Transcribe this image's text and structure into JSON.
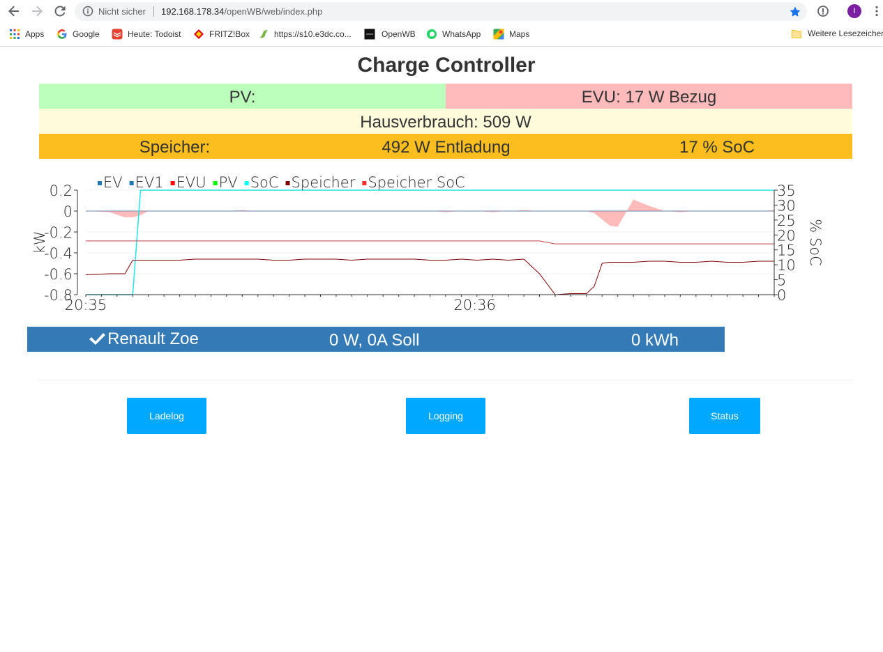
{
  "browser": {
    "security_label": "Nicht sicher",
    "url_host": "192.168.178.34",
    "url_path": "/openWB/web/index.php",
    "profile_initial": "I",
    "bookmarks": [
      {
        "label": "Apps",
        "icon": "apps-grid-icon"
      },
      {
        "label": "Google",
        "icon": "google-icon"
      },
      {
        "label": "Heute: Todoist",
        "icon": "todoist-icon"
      },
      {
        "label": "FRITZ!Box",
        "icon": "fritzbox-icon"
      },
      {
        "label": "https://s10.e3dc.co...",
        "icon": "e3dc-icon"
      },
      {
        "label": "OpenWB",
        "icon": "openwb-icon"
      },
      {
        "label": "WhatsApp",
        "icon": "whatsapp-icon"
      },
      {
        "label": "Maps",
        "icon": "maps-icon"
      }
    ],
    "other_bookmarks": "Weitere Lesezeichen"
  },
  "page": {
    "title": "Charge Controller"
  },
  "status": {
    "pv": "PV:",
    "evu": "EVU: 17 W Bezug",
    "hausverbrauch": "Hausverbrauch: 509 W",
    "speicher_label": "Speicher:",
    "speicher_power": "492 W Entladung",
    "speicher_soc": "17 % SoC"
  },
  "colors": {
    "pv_bg": "#bbffbb",
    "evu_bg": "#ffbbbb",
    "haus_bg": "#fffcdb",
    "speicher_bg": "#fcbe1e",
    "ladepunkt_bg": "#337ab7",
    "button_bg": "#00a8ff"
  },
  "chart_data": {
    "type": "line",
    "ylabel": "kW",
    "y2label": "% SoC",
    "ylim": [
      -0.8,
      0.2
    ],
    "y2lim": [
      0,
      35
    ],
    "yticks": [
      "0.2",
      "0",
      "-0.2",
      "-0.4",
      "-0.6",
      "-0.8"
    ],
    "y2ticks": [
      "35",
      "30",
      "25",
      "20",
      "15",
      "10",
      "5",
      "0"
    ],
    "x_tick_labels": [
      "20:35",
      "20:36"
    ],
    "legend": [
      "EV",
      "EV1",
      "EVU",
      "PV",
      "SoC",
      "Speicher",
      "Speicher SoC"
    ],
    "legend_position": "top-left",
    "x": [
      0,
      3,
      5,
      6,
      7,
      8,
      10,
      12,
      14,
      16,
      18,
      20,
      22,
      24,
      26,
      28,
      30,
      32,
      34,
      36,
      38,
      40,
      42,
      44,
      46,
      48,
      50,
      52,
      54,
      56,
      58,
      60,
      62,
      64,
      65,
      66,
      67,
      68,
      70,
      72,
      74,
      76,
      78,
      80,
      82,
      84,
      86,
      88
    ],
    "series": [
      {
        "name": "EV",
        "axis": "left",
        "values": [
          0,
          0,
          0,
          0,
          0,
          0,
          0,
          0,
          0,
          0,
          0,
          0,
          0,
          0,
          0,
          0,
          0,
          0,
          0,
          0,
          0,
          0,
          0,
          0,
          0,
          0,
          0,
          0,
          0,
          0,
          0,
          0,
          0,
          0,
          0,
          0,
          0,
          0,
          0,
          0,
          0,
          0,
          0,
          0,
          0,
          0,
          0,
          0
        ]
      },
      {
        "name": "EV1",
        "axis": "left",
        "values": [
          0,
          0,
          0,
          0,
          0,
          0,
          0,
          0,
          0,
          0,
          0,
          0,
          0,
          0,
          0,
          0,
          0,
          0,
          0,
          0,
          0,
          0,
          0,
          0,
          0,
          0,
          0,
          0,
          0,
          0,
          0,
          0,
          0,
          0,
          0,
          0,
          0,
          0,
          0,
          0,
          0,
          0,
          0,
          0,
          0,
          0,
          0,
          0
        ]
      },
      {
        "name": "EVU",
        "axis": "left",
        "values": [
          0,
          -0.01,
          -0.06,
          -0.06,
          -0.04,
          0,
          0,
          0,
          0,
          0,
          0,
          0.01,
          0,
          0,
          0,
          0,
          0,
          0,
          0,
          0,
          0,
          0,
          0,
          0,
          -0.01,
          0,
          0,
          -0.01,
          0,
          0.01,
          0,
          0,
          0,
          0,
          -0.02,
          -0.08,
          -0.14,
          -0.15,
          0.11,
          0.05,
          0,
          -0.01,
          0,
          0,
          0,
          0,
          0,
          0.01
        ]
      },
      {
        "name": "PV",
        "axis": "left",
        "values": [
          0,
          0,
          0,
          0,
          0,
          0,
          0,
          0,
          0,
          0,
          0,
          0,
          0,
          0,
          0,
          0,
          0,
          0,
          0,
          0,
          0,
          0,
          0,
          0,
          0,
          0,
          0,
          0,
          0,
          0,
          0,
          0,
          0,
          0,
          0,
          0,
          0,
          0,
          0,
          0,
          0,
          0,
          0,
          0,
          0,
          0,
          0,
          0
        ]
      },
      {
        "name": "SoC",
        "axis": "right",
        "values": [
          0,
          0,
          0,
          0,
          35,
          35,
          35,
          35,
          35,
          35,
          35,
          35,
          35,
          35,
          35,
          35,
          35,
          35,
          35,
          35,
          35,
          35,
          35,
          35,
          35,
          35,
          35,
          35,
          35,
          35,
          35,
          35,
          35,
          35,
          35,
          35,
          35,
          35,
          35,
          35,
          35,
          35,
          35,
          35,
          35,
          35,
          35,
          35
        ]
      },
      {
        "name": "Speicher",
        "axis": "left",
        "values": [
          -0.61,
          -0.6,
          -0.6,
          -0.47,
          -0.47,
          -0.47,
          -0.47,
          -0.47,
          -0.46,
          -0.46,
          -0.46,
          -0.46,
          -0.46,
          -0.47,
          -0.47,
          -0.46,
          -0.46,
          -0.46,
          -0.47,
          -0.46,
          -0.46,
          -0.46,
          -0.46,
          -0.47,
          -0.47,
          -0.46,
          -0.47,
          -0.46,
          -0.47,
          -0.46,
          -0.6,
          -0.8,
          -0.79,
          -0.79,
          -0.72,
          -0.5,
          -0.49,
          -0.49,
          -0.49,
          -0.48,
          -0.48,
          -0.49,
          -0.49,
          -0.48,
          -0.49,
          -0.49,
          -0.48,
          -0.48
        ]
      },
      {
        "name": "Speicher SoC",
        "axis": "right",
        "values": [
          18,
          18,
          18,
          18,
          18,
          18,
          18,
          18,
          18,
          18,
          18,
          18,
          18,
          18,
          18,
          18,
          18,
          18,
          18,
          18,
          18,
          18,
          18,
          18,
          18,
          18,
          18,
          18,
          18,
          18,
          18,
          17,
          17,
          17,
          17,
          17,
          17,
          17,
          17,
          17,
          17,
          17,
          17,
          17,
          17,
          17,
          17,
          17
        ]
      }
    ],
    "series_colors": {
      "EV": "#1f77b4",
      "EV1": "#1f77b4",
      "EVU": "#ff0000",
      "PV": "#00ff00",
      "SoC": "#00ffff",
      "Speicher": "#800000",
      "Speicher SoC": "#d62728"
    }
  },
  "ladepunkt": {
    "name": "Renault Zoe",
    "power": "0 W, 0A Soll",
    "energy": "0 kWh"
  },
  "buttons": {
    "ladelog": "Ladelog",
    "logging": "Logging",
    "status": "Status"
  }
}
